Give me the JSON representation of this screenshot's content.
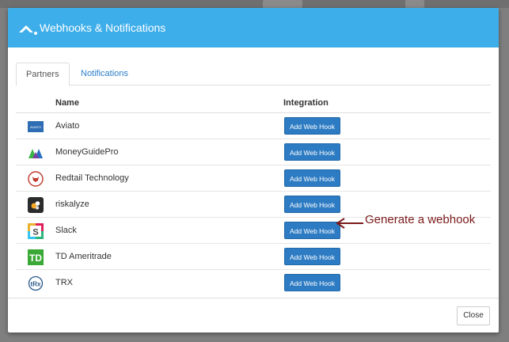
{
  "modal": {
    "title": "Webhooks & Notifications",
    "close_label": "Close"
  },
  "tabs": [
    {
      "label": "Partners",
      "active": true
    },
    {
      "label": "Notifications",
      "active": false
    }
  ],
  "table": {
    "columns": [
      "Name",
      "Integration"
    ],
    "rows": [
      {
        "name": "Aviato",
        "logo": "aviato-logo",
        "action": "Add Web Hook",
        "logo_text": "AVIATO"
      },
      {
        "name": "MoneyGuidePro",
        "logo": "moneyguidepro-logo",
        "action": "Add Web Hook"
      },
      {
        "name": "Redtail Technology",
        "logo": "redtail-logo",
        "action": "Add Web Hook"
      },
      {
        "name": "riskalyze",
        "logo": "riskalyze-logo",
        "action": "Add Web Hook"
      },
      {
        "name": "Slack",
        "logo": "slack-logo",
        "action": "Add Web Hook",
        "logo_text": "S"
      },
      {
        "name": "TD Ameritrade",
        "logo": "td-ameritrade-logo",
        "action": "Add Web Hook",
        "logo_text": "TD"
      },
      {
        "name": "TRX",
        "logo": "trx-logo",
        "action": "Add Web Hook",
        "logo_text": "tRx"
      }
    ]
  },
  "annotation": {
    "text": "Generate a webhook"
  },
  "colors": {
    "header": "#3eaeea",
    "button": "#2c7bc3",
    "link": "#2a7fc9",
    "annotation": "#7a1a1a"
  }
}
